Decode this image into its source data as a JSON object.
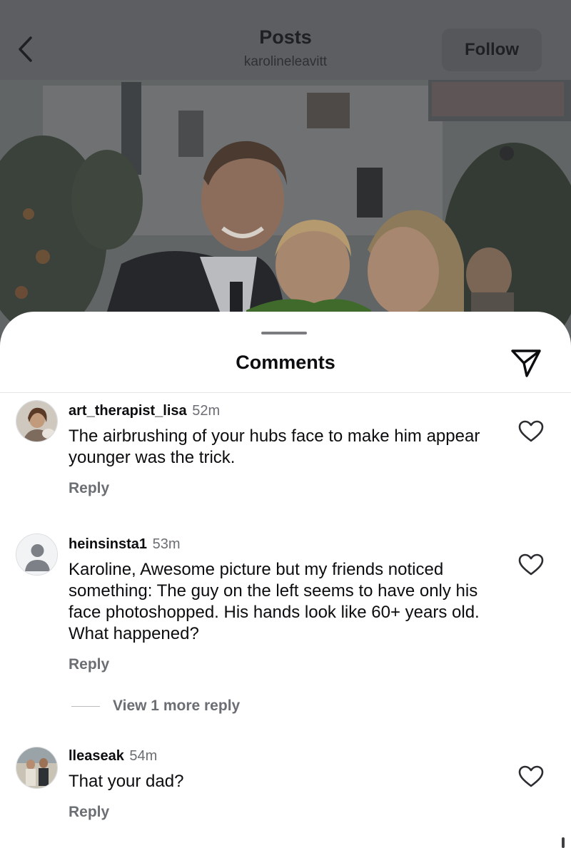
{
  "header": {
    "title": "Posts",
    "username": "karolineleavitt",
    "follow_label": "Follow",
    "back_icon": "chevron-left-icon"
  },
  "sheet": {
    "title": "Comments",
    "share_icon": "paper-plane-icon"
  },
  "comments": [
    {
      "username": "art_therapist_lisa",
      "time": "52m",
      "text": "The airbrushing of your hubs face to make him appear younger was the trick.",
      "reply_label": "Reply",
      "like_icon": "heart-outline-icon"
    },
    {
      "username": "heinsinsta1",
      "time": "53m",
      "text": "Karoline, Awesome picture but my friends noticed something: The guy on the left seems to have only his face photoshopped. His hands look like 60+ years old. What happened?",
      "reply_label": "Reply",
      "like_icon": "heart-outline-icon",
      "more_replies_label": "View 1 more reply"
    },
    {
      "username": "lleaseak",
      "time": "54m",
      "text": "That your dad?",
      "reply_label": "Reply",
      "like_icon": "heart-outline-icon"
    }
  ],
  "colors": {
    "dim_overlay": "#5c5e62",
    "secondary_text": "#6b6e73",
    "primary_text": "#0d0d0f"
  }
}
